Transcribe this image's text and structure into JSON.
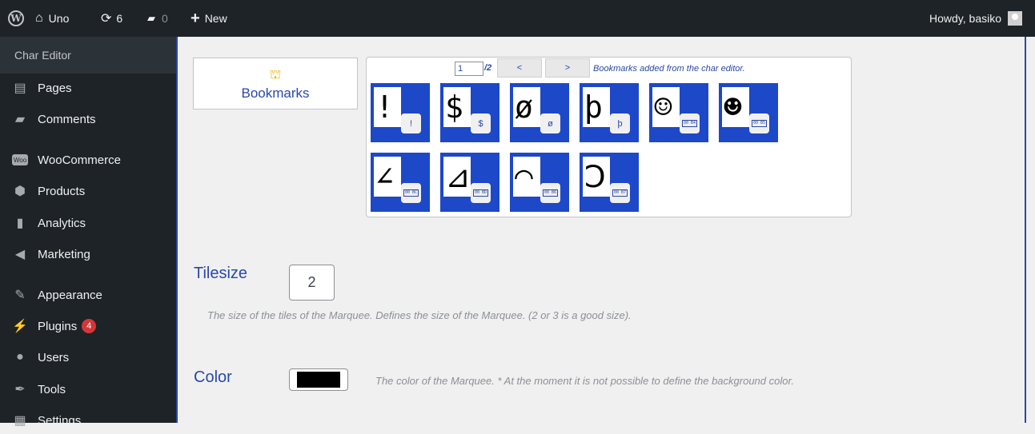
{
  "adminbar": {
    "site_name": "Uno",
    "updates_count": "6",
    "comments_count": "0",
    "new_label": "New",
    "greeting": "Howdy, basiko"
  },
  "sidebar": {
    "header": "Char Editor",
    "items": [
      {
        "label": "Pages",
        "icon": "pages-icon"
      },
      {
        "label": "Comments",
        "icon": "comments-icon"
      },
      {
        "label": "WooCommerce",
        "icon": "woocommerce-icon"
      },
      {
        "label": "Products",
        "icon": "products-icon"
      },
      {
        "label": "Analytics",
        "icon": "analytics-icon"
      },
      {
        "label": "Marketing",
        "icon": "marketing-icon"
      },
      {
        "label": "Appearance",
        "icon": "appearance-icon"
      },
      {
        "label": "Plugins",
        "icon": "plugins-icon",
        "badge": "4"
      },
      {
        "label": "Users",
        "icon": "users-icon"
      },
      {
        "label": "Tools",
        "icon": "tools-icon"
      },
      {
        "label": "Settings",
        "icon": "settings-icon"
      }
    ]
  },
  "bookmarks": {
    "title": "Bookmarks",
    "page_value": "1",
    "page_total": "/2",
    "prev_label": "<",
    "next_label": ">",
    "caption": "Bookmarks added from the char editor.",
    "tiles": [
      {
        "glyph": "!",
        "label": "!"
      },
      {
        "glyph": "$",
        "label": "$"
      },
      {
        "glyph": "ø",
        "label": "ø"
      },
      {
        "glyph": "þ",
        "label": "þ"
      },
      {
        "glyph": "☺",
        "label": "00 B4"
      },
      {
        "glyph": "☻",
        "label": "00 B5"
      },
      {
        "glyph": "∠",
        "label": "00 BC"
      },
      {
        "glyph": "⊿",
        "label": "00 BD"
      },
      {
        "glyph": "◠",
        "label": "00 B6"
      },
      {
        "glyph": "Ↄ",
        "label": "00 B7"
      }
    ]
  },
  "tilesize": {
    "title": "Tilesize",
    "value": "2",
    "help": "The size of the tiles of the Marquee. Defines the size of the Marquee. (2 or 3 is a good size)."
  },
  "color": {
    "title": "Color",
    "value": "#000000",
    "help": "The color of the Marquee. * At the moment it is not possible to define the background color."
  },
  "colors": {
    "accent": "#2949a8",
    "tile_bg": "#1d48c8",
    "adminbar_bg": "#1d2327",
    "plugins_badge": "#d63638"
  }
}
